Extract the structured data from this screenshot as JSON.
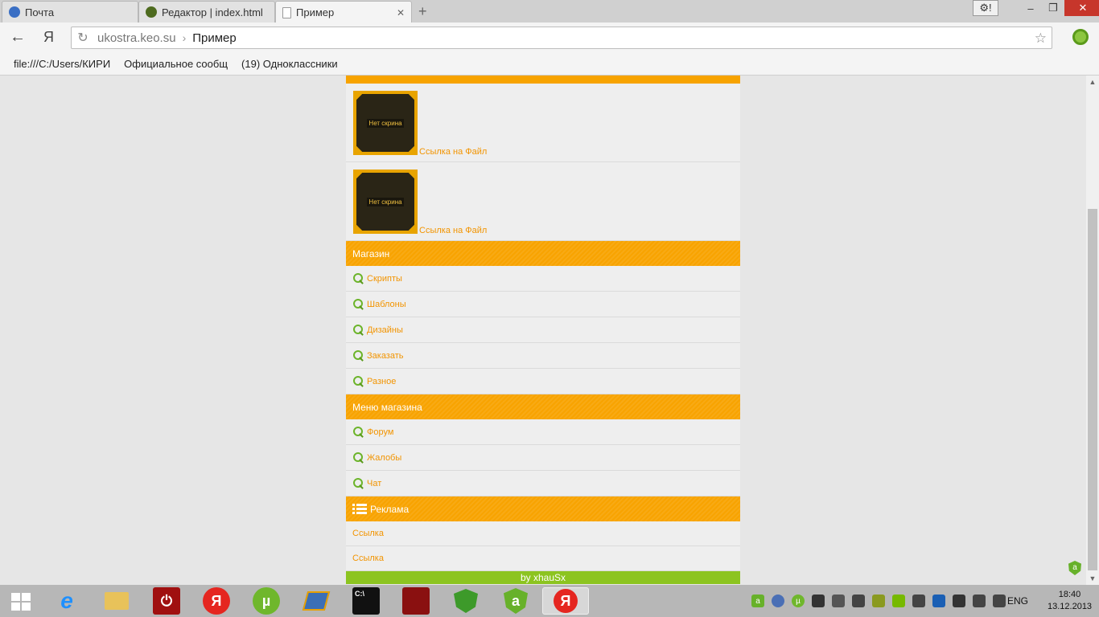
{
  "tabs": [
    {
      "title": "Почта",
      "color": "#3a6fc4"
    },
    {
      "title": "Редактор | index.html",
      "color": "#4e6b1f"
    },
    {
      "title": "Пример",
      "color": "#bbbbbb"
    }
  ],
  "address": {
    "domain": "ukostra.keo.su",
    "page": "Пример"
  },
  "nav": {
    "back": "←",
    "yandex": "Я",
    "reload": "↻",
    "star": "☆"
  },
  "window_buttons": {
    "settings": "⚙!",
    "minimize": "–",
    "maximize": "❐",
    "close": "✕"
  },
  "bookmarks": [
    "file:///C:/Users/КИРИ",
    "Официальное сообщ",
    "(19) Одноклассники"
  ],
  "page": {
    "files": [
      {
        "thumb_label": "Нет скрина",
        "link": "Ссылка на Файл"
      },
      {
        "thumb_label": "Нет скрина",
        "link": "Ссылка на Файл"
      }
    ],
    "shop": {
      "title": "Магазин",
      "items": [
        "Скрипты",
        "Шаблоны",
        "Дизайны",
        "Заказать",
        "Разное"
      ]
    },
    "shop_menu": {
      "title": "Меню магазина",
      "items": [
        "Форум",
        "Жалобы",
        "Чат"
      ]
    },
    "ads": {
      "title": "Реклама",
      "items": [
        "Ссылка",
        "Ссылка"
      ]
    },
    "footer": "by xhauSx"
  },
  "taskbar": {
    "apps": [
      {
        "name": "internet-explorer",
        "label": "e",
        "color": "#1e90ff"
      },
      {
        "name": "file-explorer",
        "label": "",
        "color": "#e8c25a"
      },
      {
        "name": "power-app",
        "label": "⏻",
        "color": "#a01010"
      },
      {
        "name": "yandex-browser",
        "label": "Я",
        "color": "#e52620"
      },
      {
        "name": "utorrent",
        "label": "µ",
        "color": "#6fb72c"
      },
      {
        "name": "media-app",
        "label": "",
        "color": "#3b6fb6"
      },
      {
        "name": "command-prompt",
        "label": "C:\\",
        "color": "#111111"
      },
      {
        "name": "game-app",
        "label": "",
        "color": "#8a1010"
      },
      {
        "name": "security-app",
        "label": "",
        "color": "#3d9a2a"
      },
      {
        "name": "adguard",
        "label": "a",
        "color": "#67b12a"
      },
      {
        "name": "yandex-browser-active",
        "label": "Я",
        "color": "#e52620"
      }
    ],
    "language": "ENG",
    "time": "18:40",
    "date": "13.12.2013"
  },
  "colors": {
    "accent": "#f8a300",
    "link": "#f29400",
    "footer": "#8cc420"
  }
}
